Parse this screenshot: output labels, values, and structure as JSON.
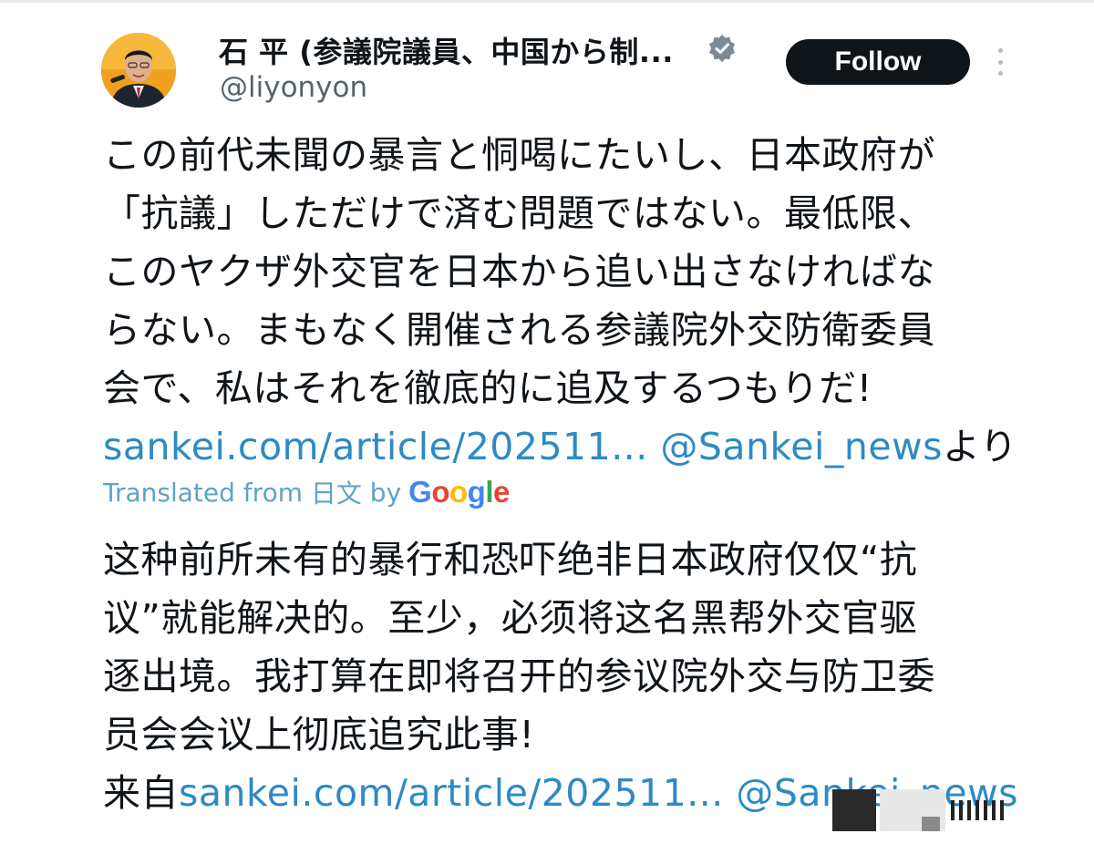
{
  "author": {
    "display_name": "石 平 (参議院議員、中国から制...",
    "handle": "@liyonyon",
    "follow_label": "Follow"
  },
  "tweet": {
    "lines": [
      "この前代未聞の暴言と恫喝にたいし、日本政府が",
      "「抗議」しただけで済む問題ではない。最低限、",
      "このヤクザ外交官を日本から追い出さなければな",
      "らない。まもなく開催される参議院外交防衛委員",
      "会で、私はそれを徹底的に追及するつもりだ!"
    ],
    "link_url": "sankei.com/article/202511...",
    "link_mention": "@Sankei_news",
    "link_suffix": "より"
  },
  "translation": {
    "label_prefix": "Translated from",
    "source_language": "日文",
    "label_by": "by",
    "provider": "Google",
    "lines": [
      "这种前所未有的暴行和恐吓绝非日本政府仅仅“抗",
      "议”就能解决的。至少，必须将这名黑帮外交官驱",
      "逐出境。我打算在即将召开的参议院外交与防卫委",
      "员会会议上彻底追究此事!"
    ],
    "source_prefix": "来自",
    "link_url": "sankei.com/article/202511...",
    "link_mention": "@Sankei_news"
  },
  "colors": {
    "link": "#2d8ac4",
    "handle": "#536471",
    "button": "#0f1419",
    "google": [
      "#4285F4",
      "#EA4335",
      "#FBBC05",
      "#4285F4",
      "#34A853",
      "#EA4335"
    ]
  }
}
